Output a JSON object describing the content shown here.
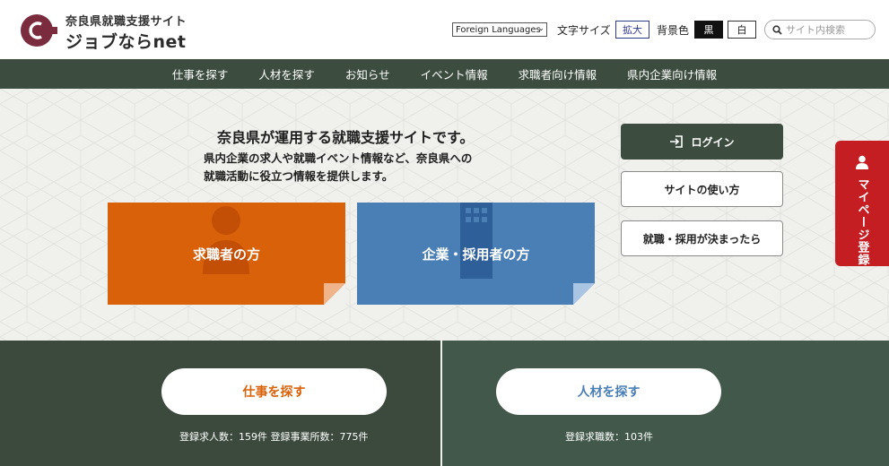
{
  "header": {
    "site_subtitle": "奈良県就職支援サイト",
    "site_name": "ジョブならnet",
    "language_select": "Foreign Languages",
    "font_size_label": "文字サイズ",
    "enlarge_label": "拡大",
    "bg_color_label": "背景色",
    "black_label": "黒",
    "white_label": "白",
    "search_placeholder": "サイト内検索"
  },
  "nav": {
    "items": [
      {
        "label": "仕事を探す"
      },
      {
        "label": "人材を探す"
      },
      {
        "label": "お知らせ"
      },
      {
        "label": "イベント情報"
      },
      {
        "label": "求職者向け情報"
      },
      {
        "label": "県内企業向け情報"
      }
    ]
  },
  "hero": {
    "title": "奈良県が運用する就職支援サイトです。",
    "desc_line1": "県内企業の求人や就職イベント情報など、奈良県への",
    "desc_line2": "就職活動に役立つ情報を提供します。",
    "card_jobseeker": "求職者の方",
    "card_employer": "企業・採用者の方",
    "login_label": "ログイン",
    "howto_label": "サイトの使い方",
    "decided_label": "就職・採用が決まったら",
    "mypage_label": "マイページ登録"
  },
  "panels": {
    "left": {
      "button": "仕事を探す",
      "stat": "登録求人数：159件 登録事業所数：775件"
    },
    "right": {
      "button": "人材を探す",
      "stat": "登録求職数：103件"
    }
  },
  "colors": {
    "brand_maroon": "#7a2b3e",
    "nav_green": "#3c4d3f",
    "orange": "#d8610a",
    "blue": "#4a7fb6",
    "red_tab": "#c41e23"
  }
}
